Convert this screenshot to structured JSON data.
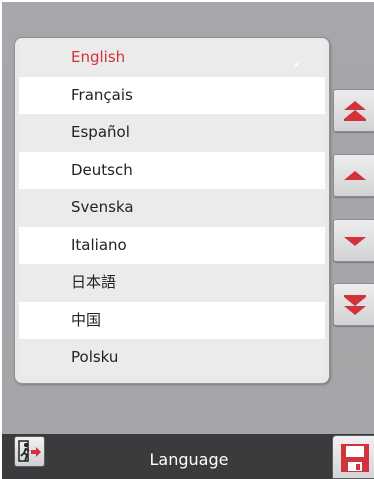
{
  "languages": [
    {
      "label": "English",
      "selected": true
    },
    {
      "label": "Français",
      "selected": false
    },
    {
      "label": "Español",
      "selected": false
    },
    {
      "label": "Deutsch",
      "selected": false
    },
    {
      "label": "Svenska",
      "selected": false
    },
    {
      "label": "Italiano",
      "selected": false
    },
    {
      "label": "日本語",
      "selected": false
    },
    {
      "label": "中国",
      "selected": false
    },
    {
      "label": "Polsku",
      "selected": false
    }
  ],
  "bottom_bar": {
    "title": "Language",
    "exit_icon": "exit-icon",
    "save_icon": "save-icon"
  },
  "scroll_buttons": {
    "top_icon": "double-chevron-up-icon",
    "up_icon": "chevron-up-icon",
    "down_icon": "chevron-down-icon",
    "bottom_icon": "double-chevron-down-icon"
  },
  "colors": {
    "accent": "#d2323a",
    "background": "#a4a6a9",
    "bar": "#3a3b3d"
  }
}
